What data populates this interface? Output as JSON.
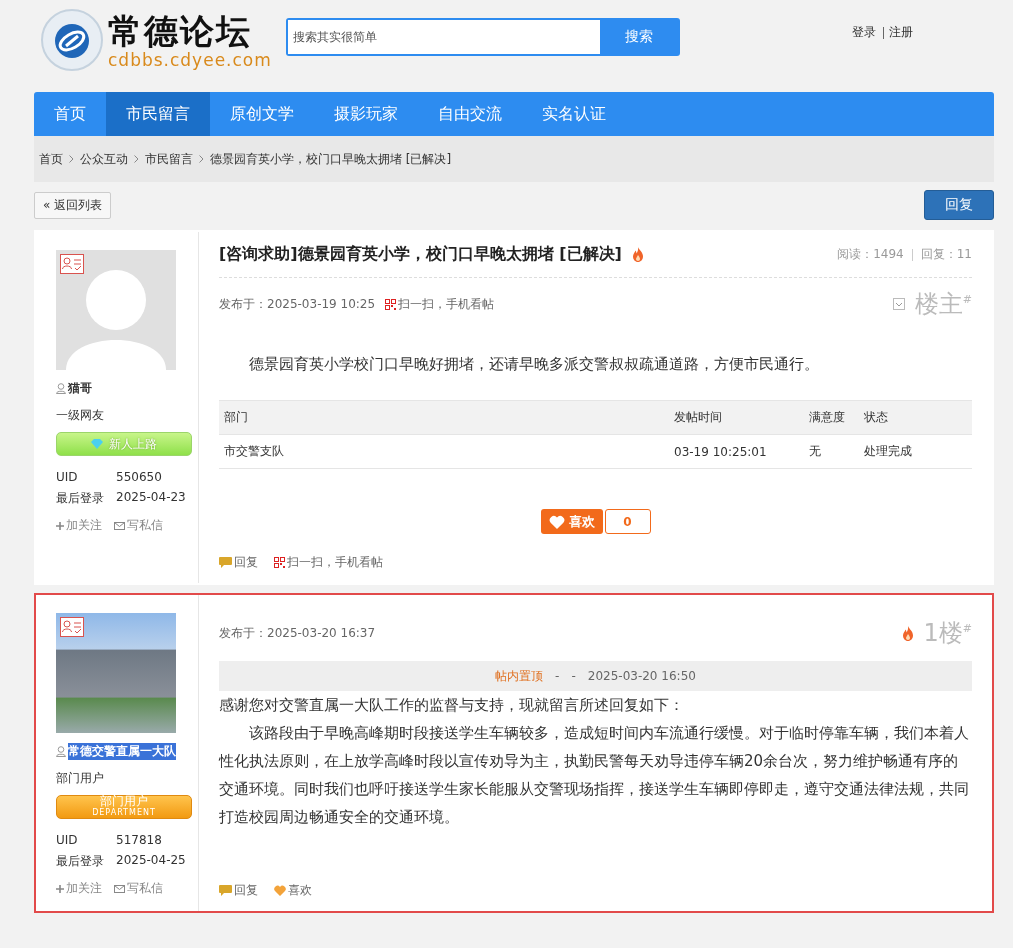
{
  "header": {
    "logo": {
      "title": "常德论坛",
      "url": "cdbbs.cdyee.com"
    },
    "search": {
      "placeholder": "搜索其实很简单",
      "button": "搜索"
    },
    "auth_links": [
      "登录",
      "注册"
    ]
  },
  "nav": [
    {
      "label": "首页",
      "selected": false
    },
    {
      "label": "市民留言",
      "selected": true
    },
    {
      "label": "原创文学",
      "selected": false
    },
    {
      "label": "摄影玩家",
      "selected": false
    },
    {
      "label": "自由交流",
      "selected": false
    },
    {
      "label": "实名认证",
      "selected": false
    }
  ],
  "breadcrumb": [
    "首页",
    "公众互动",
    "市民留言",
    "德景园育英小学，校门口早晚太拥堵 [已解决]"
  ],
  "back_button": "« 返回列表",
  "reply_button": "回复",
  "posts": [
    {
      "highlighted": false,
      "author": {
        "name": "猫哥",
        "name_selected": false,
        "avatar": {
          "kind": "placeholder"
        },
        "rank": "一级网友",
        "badge": {
          "kind": "newbie",
          "label": "新人上路"
        },
        "uid_label": "UID",
        "uid": "550650",
        "login_label": "最后登录",
        "last_login": "2025-04-23",
        "follow": "加关注",
        "message": "写私信"
      },
      "title": "[咨询求助]德景园育英小学，校门口早晚太拥堵 [已解决]",
      "hot": true,
      "views": "阅读：1494",
      "replies": "回复：11",
      "posted": "发布于：2025-03-19 10:25",
      "qr": "扫一扫，手机看帖",
      "floor": "楼主$^{#}$",
      "body": [
        {
          "text": "德景园育英小学校门口早晚好拥堵，还请早晚多派交警叔叔疏通道路，方便市民通行。",
          "indent": true
        }
      ],
      "table": {
        "columns": [
          "部门",
          "发帖时间",
          "满意度",
          "状态"
        ],
        "rows": [
          [
            "市交警支队",
            "03-19 10:25:01",
            "无",
            "处理完成"
          ]
        ]
      },
      "like": {
        "label": "喜欢",
        "count": "0"
      },
      "actions": [
        {
          "kind": "reply",
          "label": "回复"
        },
        {
          "kind": "qr",
          "label": "扫一扫，手机看帖"
        }
      ]
    },
    {
      "highlighted": true,
      "author": {
        "name": "常德交警直属一大队",
        "name_selected": true,
        "avatar": {
          "kind": "photo"
        },
        "rank": "部门用户",
        "badge": {
          "kind": "department",
          "label": "部门用户",
          "sublabel": "DEPARTMENT"
        },
        "uid_label": "UID",
        "uid": "517818",
        "login_label": "最后登录",
        "last_login": "2025-04-25",
        "follow": "加关注",
        "message": "写私信"
      },
      "posted": "发布于：2025-03-20 16:37",
      "hot": true,
      "floor": "1楼$^{#}$",
      "pinned": [
        "帖内置顶",
        "-",
        "-",
        "2025-03-20 16:50"
      ],
      "body": [
        {
          "text": "感谢您对交警直属一大队工作的监督与支持，现就留言所述回复如下：",
          "indent": false
        },
        {
          "text": "该路段由于早晚高峰期时段接送学生车辆较多，造成短时间内车流通行缓慢。对于临时停靠车辆，我们本着人性化执法原则，在上放学高峰时段以宣传劝导为主，执勤民警每天劝导违停车辆20余台次，努力维护畅通有序的交通环境。同时我们也呼吁接送学生家长能服从交警现场指挥，接送学生车辆即停即走，遵守交通法律法规，共同打造校园周边畅通安全的交通环境。",
          "indent": true
        }
      ],
      "actions": [
        {
          "kind": "reply",
          "label": "回复"
        },
        {
          "kind": "like",
          "label": "喜欢"
        }
      ]
    }
  ]
}
